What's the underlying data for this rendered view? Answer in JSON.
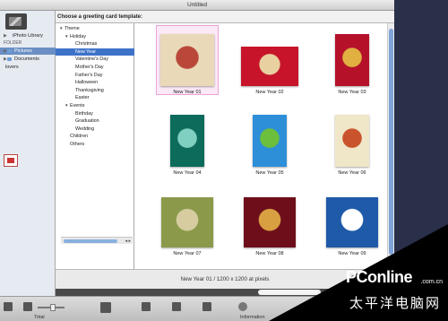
{
  "window": {
    "title": "Untitled"
  },
  "sheet": {
    "prompt": "Choose a greeting card template:"
  },
  "sources": {
    "items": [
      {
        "label": "iPhoto Library",
        "kind": "row",
        "selected": false
      },
      {
        "label": "FOLDER",
        "kind": "header",
        "selected": false
      },
      {
        "label": "Pictures",
        "kind": "folder",
        "selected": true
      },
      {
        "label": "Documents",
        "kind": "folder",
        "selected": false
      },
      {
        "label": "lovers",
        "kind": "row",
        "selected": false
      }
    ]
  },
  "categories": [
    {
      "label": "Theme",
      "level": 0,
      "expand": true,
      "selected": false
    },
    {
      "label": "Holiday",
      "level": 1,
      "expand": true,
      "selected": false
    },
    {
      "label": "Christmas",
      "level": 2,
      "expand": false,
      "selected": false
    },
    {
      "label": "New Year",
      "level": 2,
      "expand": false,
      "selected": true
    },
    {
      "label": "Valentine's Day",
      "level": 2,
      "expand": false,
      "selected": false
    },
    {
      "label": "Mother's Day",
      "level": 2,
      "expand": false,
      "selected": false
    },
    {
      "label": "Father's Day",
      "level": 2,
      "expand": false,
      "selected": false
    },
    {
      "label": "Halloween",
      "level": 2,
      "expand": false,
      "selected": false
    },
    {
      "label": "Thanksgiving",
      "level": 2,
      "expand": false,
      "selected": false
    },
    {
      "label": "Easter",
      "level": 2,
      "expand": false,
      "selected": false
    },
    {
      "label": "Events",
      "level": 1,
      "expand": true,
      "selected": false
    },
    {
      "label": "Birthday",
      "level": 2,
      "expand": false,
      "selected": false
    },
    {
      "label": "Graduation",
      "level": 2,
      "expand": false,
      "selected": false
    },
    {
      "label": "Wedding",
      "level": 2,
      "expand": false,
      "selected": false
    },
    {
      "label": "Children",
      "level": 1,
      "expand": false,
      "selected": false
    },
    {
      "label": "Others",
      "level": 1,
      "expand": false,
      "selected": false
    }
  ],
  "templates": [
    {
      "name": "New Year 01",
      "selected": true,
      "orientation": "square",
      "colors": [
        "#e9d9b8",
        "#b9483a"
      ]
    },
    {
      "name": "New Year 02",
      "selected": false,
      "orientation": "landscape",
      "colors": [
        "#c7142a",
        "#e8d0a0"
      ]
    },
    {
      "name": "New Year 03",
      "selected": false,
      "orientation": "portrait",
      "colors": [
        "#b5122a",
        "#e0b040"
      ]
    },
    {
      "name": "New Year 04",
      "selected": false,
      "orientation": "portrait",
      "colors": [
        "#0d6b5c",
        "#7fd0c0"
      ]
    },
    {
      "name": "New Year 05",
      "selected": false,
      "orientation": "portrait",
      "colors": [
        "#2d8fd8",
        "#6cbf3c"
      ]
    },
    {
      "name": "New Year 06",
      "selected": false,
      "orientation": "portrait",
      "colors": [
        "#f0e6c8",
        "#c9532c"
      ]
    },
    {
      "name": "New Year 07",
      "selected": false,
      "orientation": "landscape-tall",
      "colors": [
        "#8a9a4a",
        "#d6cca0"
      ]
    },
    {
      "name": "New Year 08",
      "selected": false,
      "orientation": "landscape-tall",
      "colors": [
        "#6e0e1a",
        "#d8a040"
      ]
    },
    {
      "name": "New Year 09",
      "selected": false,
      "orientation": "landscape-tall",
      "colors": [
        "#1f5aa8",
        "#ffffff"
      ]
    }
  ],
  "info": {
    "text": "New Year 01 / 1200 x 1200 at pixels"
  },
  "toolbar": {
    "total_label": "Total",
    "information_label": "Information"
  },
  "watermark": {
    "brand": "PConline",
    "domain": ".com.cn",
    "cn": "太平洋电脑网"
  }
}
